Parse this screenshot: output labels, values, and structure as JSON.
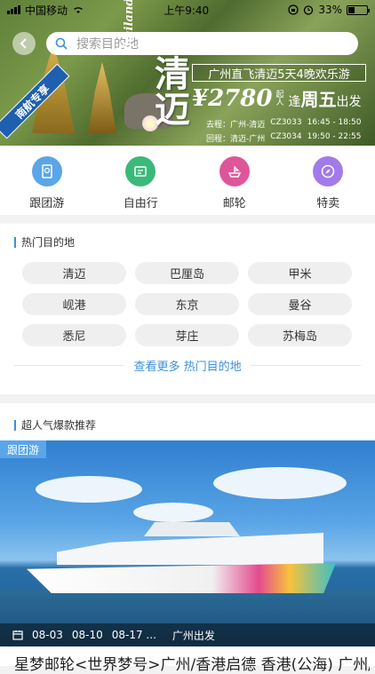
{
  "status_bar": {
    "carrier": "中国移动",
    "time": "上午9:40",
    "battery": "33%",
    "battery_level": 0.33
  },
  "banner": {
    "search_placeholder": "搜索目的地",
    "thailand_word": "Thailand",
    "city_text": "清迈",
    "promo_title": "广州直飞清迈5天4晚欢乐游",
    "price": "¥2780",
    "price_suffix": "起人",
    "weekday_prefix": "逢",
    "weekday": "周五",
    "weekday_suffix": "出发",
    "outbound": {
      "label": "去程：广州-清迈",
      "flight": "CZ3033",
      "time": "16:45 - 18:50"
    },
    "return": {
      "label": "回程：清迈-广州",
      "flight": "CZ3034",
      "time": "19:50 - 22:55"
    },
    "ribbon": "南航专享"
  },
  "categories": [
    {
      "label": "跟团游",
      "icon": "passport-icon",
      "color": "#5aa6e8"
    },
    {
      "label": "自由行",
      "icon": "boarding-icon",
      "color": "#3cb87a"
    },
    {
      "label": "邮轮",
      "icon": "cruise-icon",
      "color": "#e0559a"
    },
    {
      "label": "特卖",
      "icon": "compass-icon",
      "color": "#a27be8"
    }
  ],
  "hot": {
    "title": "热门目的地",
    "destinations": [
      "清迈",
      "巴厘岛",
      "甲米",
      "岘港",
      "东京",
      "曼谷",
      "悉尼",
      "芽庄",
      "苏梅岛"
    ],
    "more_link": "查看更多 热门目的地"
  },
  "recommend": {
    "title": "超人气爆款推荐",
    "card": {
      "tag": "跟团游",
      "dates": [
        "08-03",
        "08-10",
        "08-17 ..."
      ],
      "departure": "广州出发",
      "title": "星梦邮轮<世界梦号>广州/香港启德  香港(公海)  广州/香"
    }
  }
}
